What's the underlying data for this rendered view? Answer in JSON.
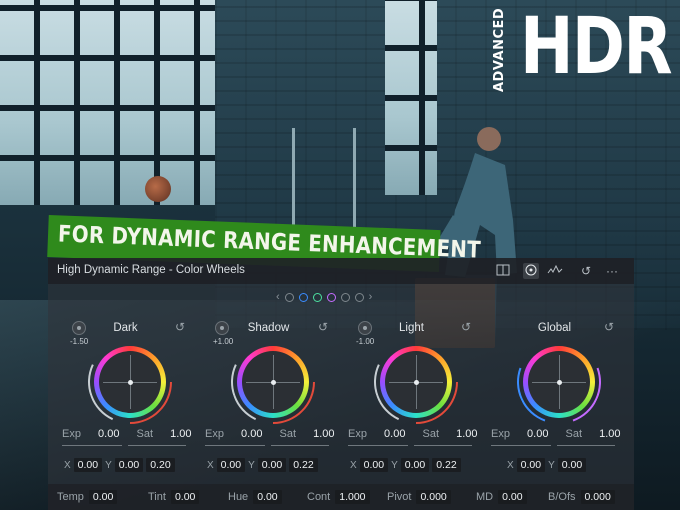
{
  "badge": {
    "hdr": "HDR",
    "advanced": "ADVANCED"
  },
  "banner": {
    "text": "FOR DYNAMIC RANGE ENHANCEMENT",
    "color": "#2f8a1c"
  },
  "panel": {
    "title": "High Dynamic Range - Color Wheels",
    "title_icons": [
      "layout-icon",
      "target-icon",
      "waveform-icon",
      "reset-icon",
      "more-icon"
    ],
    "pager": {
      "prev": "‹",
      "next": "›",
      "dot_colors": [
        "#7d868c",
        "#3a8cff",
        "#4ce0a0",
        "#c46bff",
        "#7d868c",
        "#7d868c"
      ]
    }
  },
  "wheels": [
    {
      "name": "Dark",
      "knob_value": "-1.50",
      "exp_label": "Exp",
      "exp": "0.00",
      "sat_label": "Sat",
      "sat": "1.00",
      "x_label": "X",
      "x": "0.00",
      "y_label": "Y",
      "y": "0.00",
      "z": "0.20",
      "arc_color": "#e24a3a"
    },
    {
      "name": "Shadow",
      "knob_value": "+1.00",
      "exp_label": "Exp",
      "exp": "0.00",
      "sat_label": "Sat",
      "sat": "1.00",
      "x_label": "X",
      "x": "0.00",
      "y_label": "Y",
      "y": "0.00",
      "z": "0.22",
      "arc_color": "#e24a3a"
    },
    {
      "name": "Light",
      "knob_value": "-1.00",
      "exp_label": "Exp",
      "exp": "0.00",
      "sat_label": "Sat",
      "sat": "1.00",
      "x_label": "X",
      "x": "0.00",
      "y_label": "Y",
      "y": "0.00",
      "z": "0.22",
      "arc_color": "#e24a3a"
    },
    {
      "name": "Global",
      "knob_value": "",
      "exp_label": "Exp",
      "exp": "0.00",
      "sat_label": "Sat",
      "sat": "1.00",
      "x_label": "X",
      "x": "0.00",
      "y_label": "Y",
      "y": "0.00",
      "z": "",
      "arc_color": "#c46bff"
    }
  ],
  "bottom": [
    {
      "label": "Temp",
      "value": "0.00"
    },
    {
      "label": "Tint",
      "value": "0.00"
    },
    {
      "label": "Hue",
      "value": "0.00"
    },
    {
      "label": "Cont",
      "value": "1.000"
    },
    {
      "label": "Pivot",
      "value": "0.000"
    },
    {
      "label": "MD",
      "value": "0.00"
    },
    {
      "label": "B/Ofs",
      "value": "0.000"
    }
  ]
}
